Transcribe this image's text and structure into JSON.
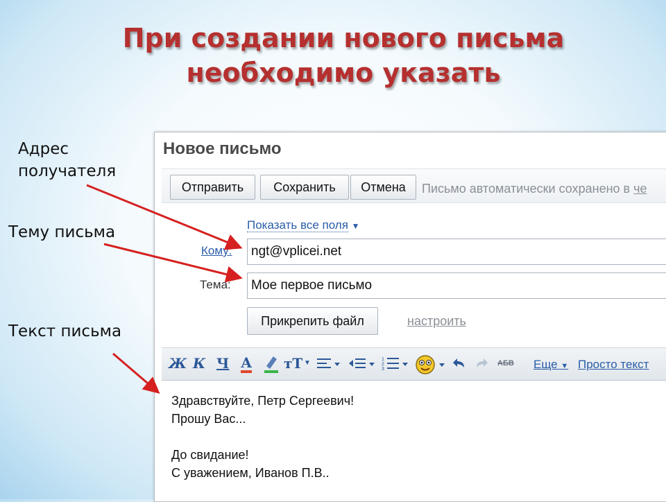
{
  "slide": {
    "title_line1": "При создании нового письма",
    "title_line2": "необходимо указать",
    "callout_address_1": "Адрес",
    "callout_address_2": "получателя",
    "callout_subject": "Тему письма",
    "callout_text": "Текст письма"
  },
  "window": {
    "title": "Новое письмо",
    "buttons": {
      "send": "Отправить",
      "save": "Сохранить",
      "cancel": "Отмена"
    },
    "save_note": "Письмо автоматически сохранено в",
    "save_note_link": "че",
    "show_all_fields": "Показать все поля",
    "to_label": "Кому:",
    "to_value": "ngt@vplicei.net",
    "subject_label": "Тема:",
    "subject_value": "Мое первое письмо",
    "attach_button": "Прикрепить файл",
    "configure_link": "настроить"
  },
  "format_toolbar": {
    "bold": "Ж",
    "italic": "К",
    "underline": "Ч",
    "text_color": "А",
    "font_size": "тТ",
    "strike": "АБВ",
    "more": "Еще",
    "plain_text": "Просто текст",
    "text_color_accent": "#e0462c",
    "highlight_accent": "#39b54a"
  },
  "message": {
    "lines": [
      "Здравствуйте, Петр Сергеевич!",
      "Прошу Вас...",
      "",
      "До свидание!",
      "С уважением, Иванов П.В.."
    ]
  },
  "colors": {
    "title": "#b5302f",
    "arrow": "#d62020",
    "link": "#2a5da8"
  }
}
